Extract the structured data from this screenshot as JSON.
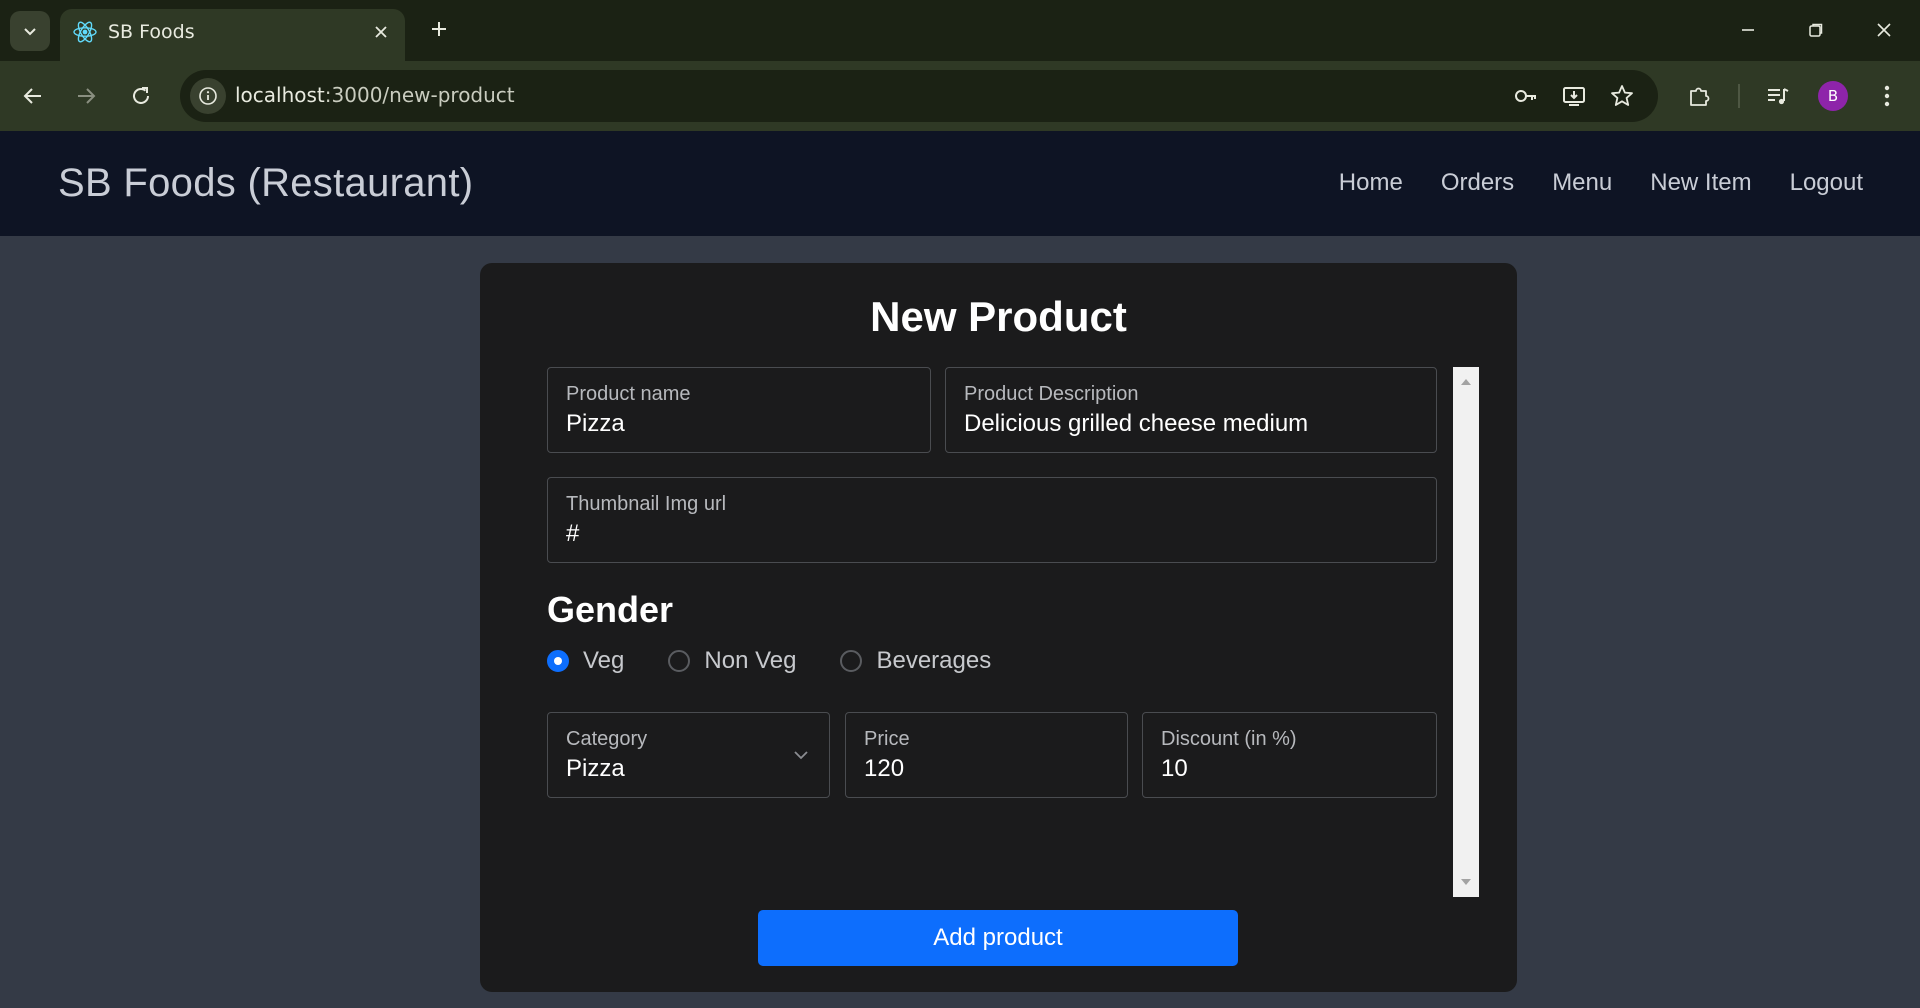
{
  "browser": {
    "tab": {
      "title": "SB Foods",
      "favicon": "react-icon"
    },
    "url": {
      "host": "localhost",
      "path": ":3000/new-product"
    },
    "profile_initial": "B",
    "accent": "#8e24aa"
  },
  "navbar": {
    "brand": "SB Foods (Restaurant)",
    "links": [
      {
        "label": "Home"
      },
      {
        "label": "Orders"
      },
      {
        "label": "Menu"
      },
      {
        "label": "New Item"
      },
      {
        "label": "Logout"
      }
    ]
  },
  "form": {
    "title": "New Product",
    "product_name": {
      "label": "Product name",
      "value": "Pizza"
    },
    "product_description": {
      "label": "Product Description",
      "value": "Delicious grilled cheese medium"
    },
    "thumbnail": {
      "label": "Thumbnail Img url",
      "value": "#"
    },
    "gender": {
      "title": "Gender",
      "options": [
        {
          "label": "Veg",
          "checked": true
        },
        {
          "label": "Non Veg",
          "checked": false
        },
        {
          "label": "Beverages",
          "checked": false
        }
      ]
    },
    "category": {
      "label": "Category",
      "value": "Pizza"
    },
    "price": {
      "label": "Price",
      "value": "120"
    },
    "discount": {
      "label": "Discount (in %)",
      "value": "10"
    },
    "submit_label": "Add product",
    "submit_color": "#0d6efd"
  }
}
